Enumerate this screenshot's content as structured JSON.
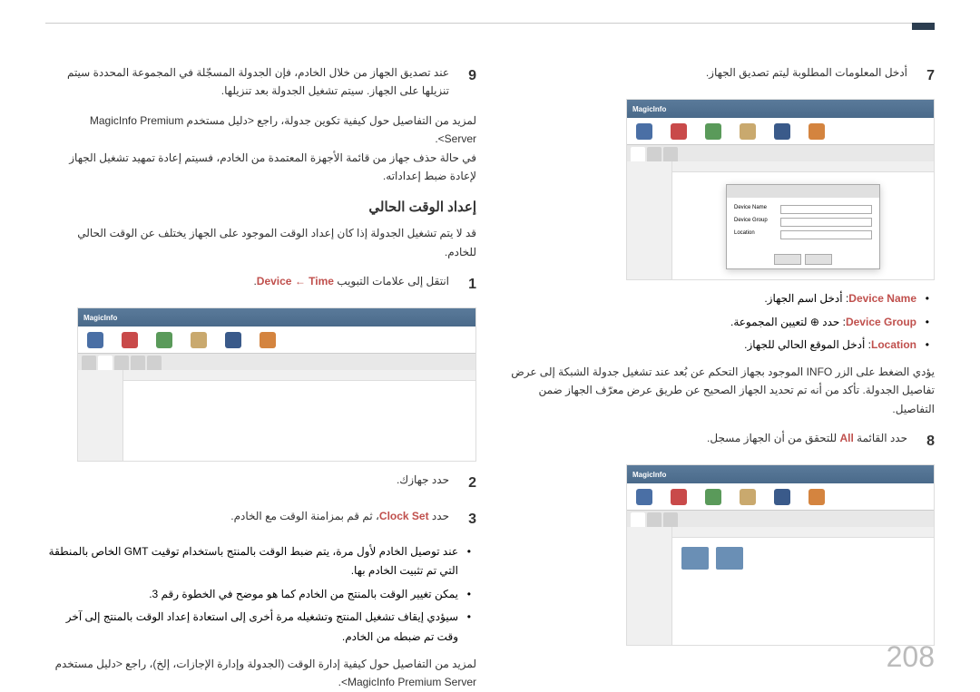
{
  "page_number": "208",
  "right_column": {
    "step7": {
      "num": "7",
      "text": "أدخل المعلومات المطلوبة ليتم تصديق الجهاز."
    },
    "screenshot1": {
      "logo": "MagicInfo",
      "dialog_fields": [
        "Device Name",
        "Device Group",
        "Location"
      ]
    },
    "fields": [
      {
        "label": "Device Name",
        "desc": ": أدخل اسم الجهاز."
      },
      {
        "label": "Device Group",
        "desc": ": حدد ⊕ لتعيين المجموعة."
      },
      {
        "label": "Location",
        "desc": ": أدخل الموقع الحالي للجهاز."
      }
    ],
    "info_note": "يؤدي الضغط على الزر INFO الموجود بجهاز التحكم عن بُعد عند تشغيل جدولة الشبكة إلى عرض تفاصيل الجدولة. تأكد من أنه تم تحديد الجهاز الصحيح عن طريق عرض معرّف الجهاز ضمن التفاصيل.",
    "step8": {
      "num": "8",
      "text_pre": "حدد القائمة ",
      "text_highlight": "All",
      "text_post": " للتحقق من أن الجهاز مسجل."
    }
  },
  "left_column": {
    "step9": {
      "num": "9",
      "text": "عند تصديق الجهاز من خلال الخادم، فإن الجدولة المسجّلة في المجموعة المحددة سيتم تنزيلها على الجهاز. سيتم تشغيل الجدولة بعد تنزيلها."
    },
    "notes": [
      "لمزيد من التفاصيل حول كيفية تكوين جدولة، راجع <دليل مستخدم MagicInfo Premium Server>.",
      "في حالة حذف جهاز من قائمة الأجهزة المعتمدة من الخادم، فسيتم إعادة تمهيد تشغيل الجهاز لإعادة ضبط إعداداته."
    ],
    "heading_current_time": "إعداد الوقت الحالي",
    "time_note": "قد لا يتم تشغيل الجدولة إذا كان إعداد الوقت الموجود على الجهاز يختلف عن الوقت الحالي للخادم.",
    "step1": {
      "num": "1",
      "text_pre": "انتقل إلى علامات التبويب",
      "nav1": "Device",
      "arrow": " ← ",
      "nav2": "Time"
    },
    "step2": {
      "num": "2",
      "text": "حدد جهازك."
    },
    "step3": {
      "num": "3",
      "text_pre": "حدد ",
      "highlight": "Clock Set",
      "text_post": "، ثم قم بمزامنة الوقت مع الخادم."
    },
    "time_bullets": [
      "عند توصيل الخادم لأول مرة، يتم ضبط الوقت بالمنتج باستخدام توقيت GMT الخاص بالمنطقة التي تم تثبيت الخادم بها.",
      "يمكن تغيير الوقت بالمنتج من الخادم كما هو موضح في الخطوة رقم 3.",
      "سيؤدي إيقاف تشغيل المنتج وتشغيله مرة أخرى إلى استعادة إعداد الوقت بالمنتج إلى آخر وقت تم ضبطه من الخادم."
    ],
    "more_details": "لمزيد من التفاصيل حول كيفية إدارة الوقت (الجدولة وإدارة الإجازات، إلخ)، راجع <دليل مستخدم MagicInfo Premium Server>."
  }
}
